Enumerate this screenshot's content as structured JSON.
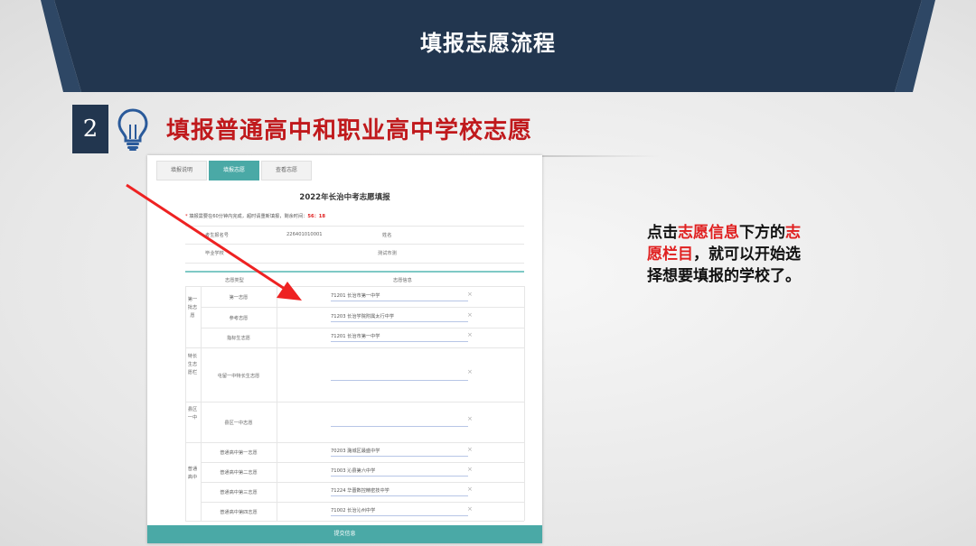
{
  "header": {
    "title": "填报志愿流程"
  },
  "step": {
    "number": "2",
    "title": "填报普通高中和职业高中学校志愿"
  },
  "icons": {
    "step_icon": "lightbulb-icon",
    "clear_icon": "close-icon"
  },
  "colors": {
    "header_bg": "#22364f",
    "accent_red": "#c0191c",
    "teal": "#4aa9a6"
  },
  "screenshot": {
    "tabs": [
      {
        "label": "填报说明",
        "active": false
      },
      {
        "label": "填报志愿",
        "active": true
      },
      {
        "label": "查看志愿",
        "active": false
      }
    ],
    "form_title": "2022年长治中考志愿填报",
    "notice_prefix": "填报需要在60分钟内完成，超时请重新填报，剩余时间：",
    "notice_min": "56",
    "notice_sep": "：",
    "notice_sec": "18",
    "info": {
      "exam_no_label": "考生报名号",
      "exam_no_value": "226401010001",
      "name_label": "姓名",
      "school_label": "毕业学校",
      "school_value": "测试市测"
    },
    "col_type": "志愿类型",
    "col_info": "志愿信息",
    "groups": [
      {
        "label": "第一批志愿",
        "rows": [
          {
            "type": "第一志愿",
            "value": "71201  长治市第一中学"
          },
          {
            "type": "参考志愿",
            "value": "71203  长治学院附属太行中学"
          },
          {
            "type": "指标生志愿",
            "value": "71201  长治市第一中学"
          }
        ]
      },
      {
        "label": "特长生志愿栏",
        "rows": [
          {
            "type": "屯留一中特长生志愿",
            "value": ""
          }
        ]
      },
      {
        "label": "县区一中",
        "rows": [
          {
            "type": "县区一中志愿",
            "value": ""
          }
        ]
      },
      {
        "label": "普通高中",
        "rows": [
          {
            "type": "普通高中第一志愿",
            "value": "70203  潞城区最盛中学"
          },
          {
            "type": "普通高中第二志愿",
            "value": "71003  沁县第六中学"
          },
          {
            "type": "普通高中第三志愿",
            "value": "71224  华晋数控精密技中学"
          },
          {
            "type": "普通高中第四志愿",
            "value": "71002  长治沁州中学"
          }
        ]
      }
    ],
    "submit_label": "提交信息"
  },
  "callout": {
    "p1": "点击",
    "h1": "志愿信息",
    "p2": "下方的",
    "h2": "志愿栏目",
    "p3": "，就可以开始选择想要填报的学校了。"
  }
}
